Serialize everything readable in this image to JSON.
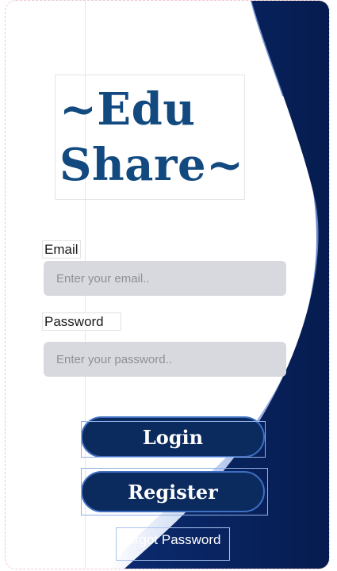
{
  "logo": {
    "line1": "~Edu",
    "line2": "Share~"
  },
  "email": {
    "label": "Email",
    "placeholder": "Enter your email.."
  },
  "password": {
    "label": "Password",
    "placeholder": "Enter your password.."
  },
  "buttons": {
    "login": "Login",
    "register": "Register",
    "forgot": "Forgot Password"
  },
  "colors": {
    "brand": "#124a80",
    "button": "#0b2a5e",
    "input_bg": "#d7d9de",
    "wave_dark": "#061c4f"
  }
}
